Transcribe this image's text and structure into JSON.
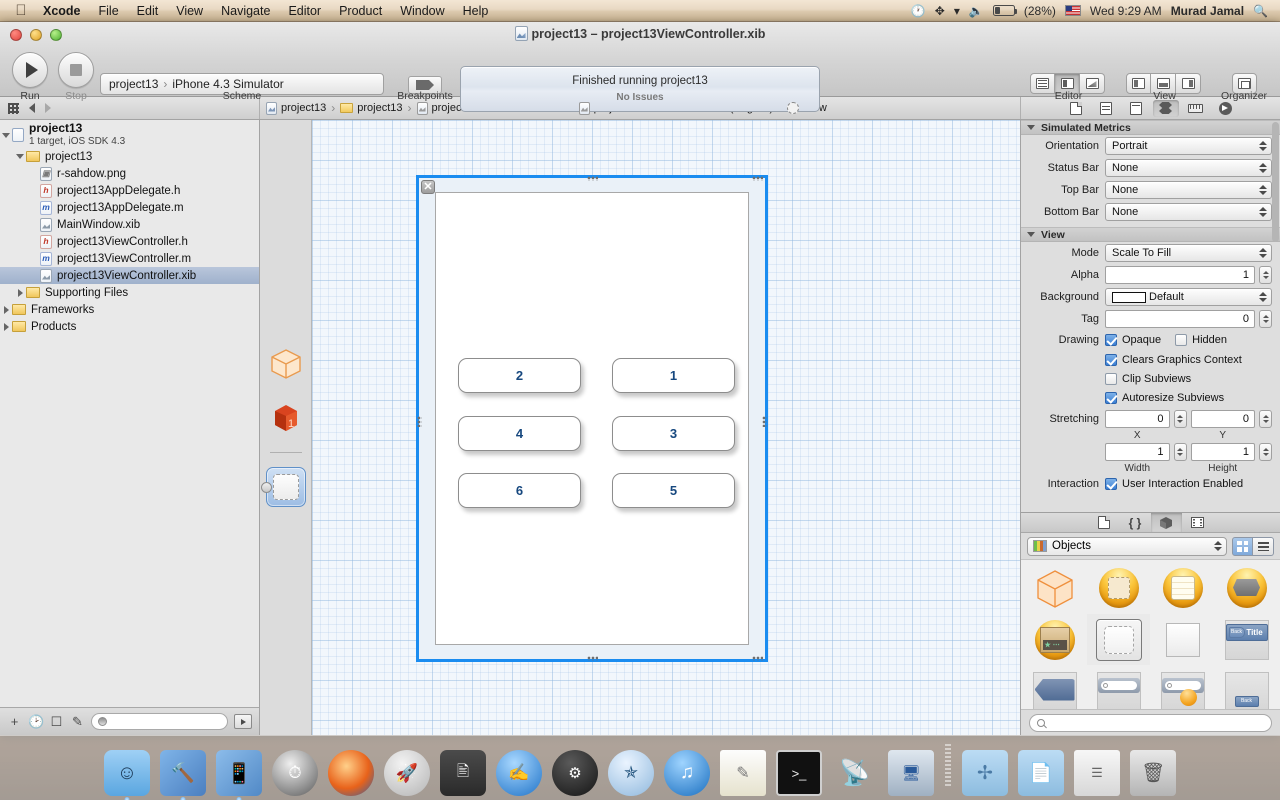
{
  "menubar": {
    "apple_icon": "apple-icon",
    "items": [
      {
        "label": "Xcode",
        "bold": true
      },
      {
        "label": "File",
        "bold": false
      },
      {
        "label": "Edit",
        "bold": false
      },
      {
        "label": "View",
        "bold": false
      },
      {
        "label": "Navigate",
        "bold": false
      },
      {
        "label": "Editor",
        "bold": false
      },
      {
        "label": "Product",
        "bold": false
      },
      {
        "label": "Window",
        "bold": false
      },
      {
        "label": "Help",
        "bold": false
      }
    ],
    "status": {
      "time_machine_icon": "time-machine-icon",
      "bluetooth_icon": "bluetooth-icon",
      "wifi_icon": "wifi-icon",
      "volume_icon": "volume-icon",
      "battery_icon": "battery-icon",
      "battery_percent": "(28%)",
      "flag_icon": "us-flag-icon",
      "clock": "Wed 9:29 AM",
      "user": "Murad Jamal",
      "spotlight_icon": "search-icon"
    }
  },
  "window": {
    "title": "project13 – project13ViewController.xib",
    "title_icon": "xib-file-icon"
  },
  "toolbar": {
    "run_label": "Run",
    "stop_label": "Stop",
    "run_icon": "play-icon",
    "stop_icon": "stop-icon",
    "scheme_project": "project13",
    "scheme_target": "iPhone 4.3 Simulator",
    "scheme_label": "Scheme",
    "breakpoints_label": "Breakpoints",
    "breakpoint_icon": "breakpoint-icon",
    "status_line1": "Finished running project13",
    "status_line2": "No Issues",
    "editor_label": "Editor",
    "view_label": "View",
    "organizer_label": "Organizer",
    "editor_icons": [
      "standard-editor-icon",
      "assistant-editor-icon",
      "version-editor-icon"
    ],
    "view_icons": [
      "toggle-navigator-icon",
      "toggle-debug-area-icon",
      "toggle-utilities-icon"
    ],
    "organizer_icon": "organizer-icon"
  },
  "jumpbar": {
    "grid_icon": "related-items-icon",
    "back_icon": "back-arrow-icon",
    "forward_icon": "forward-arrow-icon",
    "crumbs": [
      {
        "label": "project13",
        "icon": "project-icon"
      },
      {
        "label": "project13",
        "icon": "folder-icon"
      },
      {
        "label": "project13ViewController.xib",
        "icon": "xib-file-icon"
      },
      {
        "label": "project13ViewController.xib (English)",
        "icon": "xib-file-icon"
      },
      {
        "label": "View",
        "icon": "view-object-icon"
      }
    ],
    "inspector_tabs": [
      "file-inspector-icon",
      "quick-help-icon",
      "identity-inspector-icon",
      "attributes-inspector-icon",
      "size-inspector-icon",
      "connections-inspector-icon"
    ],
    "active_inspector_index": 3
  },
  "navigator": {
    "items": [
      {
        "label": "project13",
        "sub": "1 target, iOS SDK 4.3",
        "icon": "project-icon",
        "indent": 0,
        "twisty": "open",
        "selected": false,
        "type": "project"
      },
      {
        "label": "project13",
        "icon": "folder-icon",
        "indent": 1,
        "twisty": "open",
        "selected": false,
        "type": "folder"
      },
      {
        "label": "r-sahdow.png",
        "icon": "png-file-icon",
        "indent": 2,
        "twisty": "none",
        "selected": false,
        "type": "png"
      },
      {
        "label": "project13AppDelegate.h",
        "icon": "header-file-icon",
        "indent": 2,
        "twisty": "none",
        "selected": false,
        "type": "h"
      },
      {
        "label": "project13AppDelegate.m",
        "icon": "implementation-file-icon",
        "indent": 2,
        "twisty": "none",
        "selected": false,
        "type": "m"
      },
      {
        "label": "MainWindow.xib",
        "icon": "xib-file-icon",
        "indent": 2,
        "twisty": "none",
        "selected": false,
        "type": "xib"
      },
      {
        "label": "project13ViewController.h",
        "icon": "header-file-icon",
        "indent": 2,
        "twisty": "none",
        "selected": false,
        "type": "h"
      },
      {
        "label": "project13ViewController.m",
        "icon": "implementation-file-icon",
        "indent": 2,
        "twisty": "none",
        "selected": false,
        "type": "m"
      },
      {
        "label": "project13ViewController.xib",
        "icon": "xib-file-icon",
        "indent": 2,
        "twisty": "none",
        "selected": true,
        "type": "xib"
      },
      {
        "label": "Supporting Files",
        "icon": "folder-icon",
        "indent": 1,
        "twisty": "closed",
        "selected": false,
        "type": "folder"
      },
      {
        "label": "Frameworks",
        "icon": "folder-icon",
        "indent": 0,
        "twisty": "closed",
        "selected": false,
        "type": "folder"
      },
      {
        "label": "Products",
        "icon": "folder-icon",
        "indent": 0,
        "twisty": "closed",
        "selected": false,
        "type": "folder"
      }
    ],
    "bottom_bar": {
      "add_icon": "add-icon",
      "recent_icon": "recent-files-icon",
      "source_control_icon": "source-control-icon",
      "unsaved_icon": "unsaved-files-icon",
      "filter_placeholder": "",
      "filter_value": "",
      "filter_icon": "filter-icon",
      "expand_icon": "show-hide-icon"
    }
  },
  "dock_strip": {
    "items": [
      {
        "name": "files-owner-icon",
        "label": "File's Owner"
      },
      {
        "name": "first-responder-icon",
        "label": "First Responder"
      },
      {
        "name": "view-object-icon",
        "label": "View",
        "selected": true
      }
    ]
  },
  "canvas": {
    "close_icon": "close-icon",
    "buttons": [
      {
        "label": "2",
        "col": 0,
        "row": 0
      },
      {
        "label": "1",
        "col": 1,
        "row": 0
      },
      {
        "label": "4",
        "col": 0,
        "row": 1
      },
      {
        "label": "3",
        "col": 1,
        "row": 1
      },
      {
        "label": "6",
        "col": 0,
        "row": 2
      },
      {
        "label": "5",
        "col": 1,
        "row": 2
      }
    ],
    "button_text_color": "#17487f",
    "selection_color": "#1a8cf0"
  },
  "inspector": {
    "simulated_metrics": {
      "title": "Simulated Metrics",
      "rows": [
        {
          "label": "Orientation",
          "value": "Portrait"
        },
        {
          "label": "Status Bar",
          "value": "None"
        },
        {
          "label": "Top Bar",
          "value": "None"
        },
        {
          "label": "Bottom Bar",
          "value": "None"
        }
      ]
    },
    "view": {
      "title": "View",
      "mode_label": "Mode",
      "mode_value": "Scale To Fill",
      "alpha_label": "Alpha",
      "alpha_value": "1",
      "background_label": "Background",
      "background_value": "Default",
      "tag_label": "Tag",
      "tag_value": "0",
      "drawing_label": "Drawing",
      "drawing_options": [
        {
          "label": "Opaque",
          "checked": true
        },
        {
          "label": "Hidden",
          "checked": false
        },
        {
          "label": "Clears Graphics Context",
          "checked": true
        },
        {
          "label": "Clip Subviews",
          "checked": false
        },
        {
          "label": "Autoresize Subviews",
          "checked": true
        }
      ],
      "stretching_label": "Stretching",
      "stretching_x": "0",
      "stretching_y": "0",
      "stretching_x_label": "X",
      "stretching_y_label": "Y",
      "stretching_width": "1",
      "stretching_height": "1",
      "stretching_width_label": "Width",
      "stretching_height_label": "Height",
      "interaction_label": "Interaction",
      "interaction_option": {
        "label": "User Interaction Enabled",
        "checked": true
      }
    }
  },
  "library": {
    "tabs": [
      "file-template-library-icon",
      "code-snippet-library-icon",
      "object-library-icon",
      "media-library-icon"
    ],
    "active_tab_index": 2,
    "filter_value": "Objects",
    "filter_icon": "library-icon",
    "grid_view_icon": "grid-view-icon",
    "list_view_icon": "list-view-icon",
    "active_view": "grid",
    "objects": [
      {
        "name": "view-controller-object",
        "style": "wirecube"
      },
      {
        "name": "view-object",
        "style": "gold-dashed"
      },
      {
        "name": "table-view-object",
        "style": "gold-lined"
      },
      {
        "name": "navigation-controller-object",
        "style": "gold-hex"
      },
      {
        "name": "tab-bar-controller-object",
        "style": "gold-box"
      },
      {
        "name": "view-generic-object",
        "style": "sel-dashed",
        "selected": true
      },
      {
        "name": "plain-view-object",
        "style": "plain"
      },
      {
        "name": "navigation-bar-object",
        "style": "navbar",
        "title": "Title",
        "back": "Back"
      },
      {
        "name": "navigation-item-object",
        "style": "tag"
      },
      {
        "name": "search-bar-object",
        "style": "searchbar"
      },
      {
        "name": "search-bar-display-controller-object",
        "style": "searchbar-ball"
      },
      {
        "name": "toolbar-object",
        "style": "grayslab",
        "button": "Back"
      }
    ],
    "search_placeholder": "",
    "search_icon": "search-icon"
  },
  "os_dock": {
    "items": [
      "finder-icon",
      "xcode-icon",
      "ios-simulator-icon",
      "instruments-icon",
      "firefox-icon",
      "launchpad-icon",
      "mission-control-icon",
      "app-store-icon",
      "dashboard-icon",
      "safari-icon",
      "itunes-icon",
      "stickies-icon",
      "terminal-icon",
      "airport-utility-icon",
      "remote-desktop-icon",
      "applications-folder-icon",
      "documents-folder-icon",
      "downloads-stack-icon",
      "trash-icon"
    ]
  }
}
